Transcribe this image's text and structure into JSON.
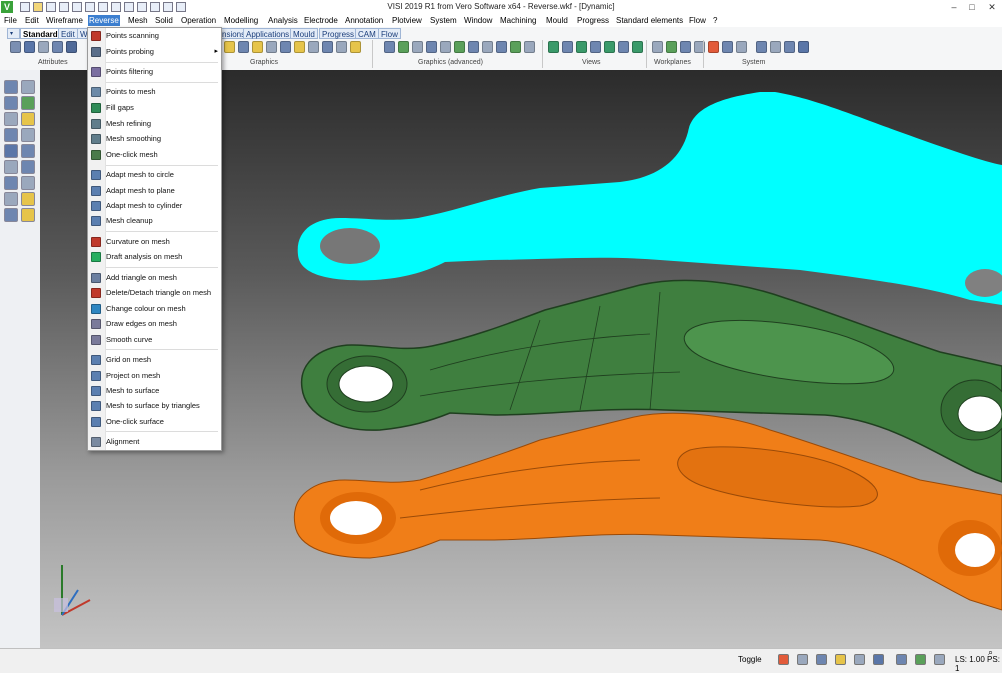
{
  "window": {
    "title": "VISI 2019 R1 from Vero Software x64 - Reverse.wkf - [Dynamic]",
    "logo": "V",
    "controls": {
      "minimize": "–",
      "maximize": "□",
      "close": "✕"
    }
  },
  "menubar": {
    "items": [
      "File",
      "Edit",
      "Wireframe",
      "Reverse",
      "Mesh",
      "Solid",
      "Operation",
      "Modelling",
      "Analysis",
      "Electrode",
      "Annotation",
      "Plotview",
      "System",
      "Window",
      "Machining",
      "Mould",
      "Progress",
      "Standard elements",
      "Flow",
      "?"
    ],
    "active": "Reverse"
  },
  "ribbon": {
    "tabs": [
      "Standard",
      "Edit",
      "W",
      "nsions",
      "Applications",
      "Mould",
      "Progress",
      "CAM",
      "Flow"
    ],
    "active_tab": "Standard",
    "groups": [
      "Attributes",
      "Graphics",
      "Graphics (advanced)",
      "Views",
      "Workplanes",
      "System"
    ]
  },
  "reverse_menu": {
    "items": [
      {
        "label": "Points scanning",
        "icon": "scanner-icon",
        "color": "#c0392b"
      },
      {
        "label": "Points probing",
        "icon": "probe-icon",
        "color": "#5a6e8a",
        "submenu": true,
        "arrow": "▸"
      },
      {
        "label": "Points filtering",
        "icon": "filter-icon",
        "color": "#7a6ea0"
      },
      {
        "label": "Points to mesh",
        "icon": "points-mesh-icon",
        "color": "#6c8aa8"
      },
      {
        "label": "Fill gaps",
        "icon": "fill-gaps-icon",
        "color": "#2e8b57"
      },
      {
        "label": "Mesh refining",
        "icon": "mesh-refine-icon",
        "color": "#607d8b"
      },
      {
        "label": "Mesh smoothing",
        "icon": "mesh-smooth-icon",
        "color": "#607d8b"
      },
      {
        "label": "One-click mesh",
        "icon": "one-click-mesh-icon",
        "color": "#4a7a4a"
      },
      {
        "label": "Adapt mesh to circle",
        "icon": "adapt-circle-icon",
        "color": "#5b7fb0"
      },
      {
        "label": "Adapt mesh to plane",
        "icon": "adapt-plane-icon",
        "color": "#5b7fb0"
      },
      {
        "label": "Adapt mesh to cylinder",
        "icon": "adapt-cylinder-icon",
        "color": "#5b7fb0"
      },
      {
        "label": "Mesh cleanup",
        "icon": "mesh-cleanup-icon",
        "color": "#5b7fb0"
      },
      {
        "label": "Curvature on mesh",
        "icon": "curvature-icon",
        "color": "#c0392b"
      },
      {
        "label": "Draft analysis on mesh",
        "icon": "draft-analysis-icon",
        "color": "#27ae60"
      },
      {
        "label": "Add triangle on mesh",
        "icon": "add-triangle-icon",
        "color": "#6b7fa0"
      },
      {
        "label": "Delete/Detach triangle on mesh",
        "icon": "delete-triangle-icon",
        "color": "#c0392b"
      },
      {
        "label": "Change colour on mesh",
        "icon": "colour-mesh-icon",
        "color": "#2e86c1"
      },
      {
        "label": "Draw edges on mesh",
        "icon": "draw-edges-icon",
        "color": "#7a7a9a"
      },
      {
        "label": "Smooth curve",
        "icon": "smooth-curve-icon",
        "color": "#7a7a9a"
      },
      {
        "label": "Grid on mesh",
        "icon": "grid-mesh-icon",
        "color": "#5b7fb0"
      },
      {
        "label": "Project on mesh",
        "icon": "project-mesh-icon",
        "color": "#5b7fb0"
      },
      {
        "label": "Mesh to surface",
        "icon": "mesh-surface-icon",
        "color": "#5b7fb0"
      },
      {
        "label": "Mesh to surface by triangles",
        "icon": "mesh-surface-triangles-icon",
        "color": "#5b7fb0"
      },
      {
        "label": "One-click surface",
        "icon": "one-click-surface-icon",
        "color": "#5b7fb0"
      },
      {
        "label": "Alignment",
        "icon": "alignment-icon",
        "color": "#7a8aa0"
      }
    ]
  },
  "status_bar": {
    "toggle": "Toggle",
    "ls": "LS: 1.00 PS: 1"
  },
  "colors": {
    "part_cyan": "#00ffff",
    "part_green": "#3f7f3f",
    "part_orange": "#f07e18",
    "menu_highlight": "#3c7fd0"
  }
}
